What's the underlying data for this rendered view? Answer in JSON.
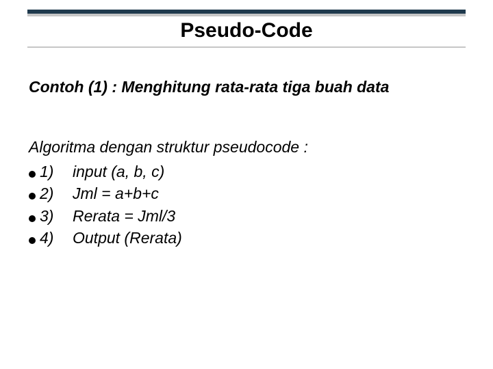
{
  "title": "Pseudo-Code",
  "subtitle": "Contoh (1) : Menghitung rata-rata tiga buah data",
  "section_lead": "Algoritma dengan struktur pseudocode :",
  "items": [
    {
      "num": "1)",
      "code": "input (a, b, c)"
    },
    {
      "num": "2)",
      "code": "Jml = a+b+c"
    },
    {
      "num": "3)",
      "code": "Rerata = Jml/3"
    },
    {
      "num": "4)",
      "code": "Output (Rerata)"
    }
  ]
}
